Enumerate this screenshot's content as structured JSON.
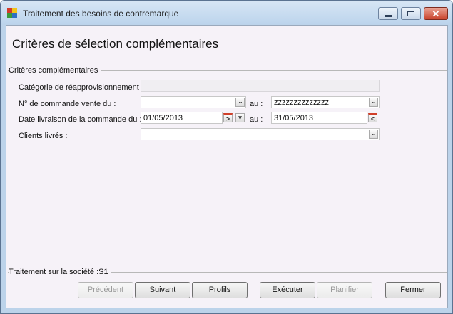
{
  "window": {
    "title": "Traitement des besoins de contremarque",
    "minimize_icon": "minimize-icon",
    "maximize_icon": "maximize-icon",
    "close_glyph": "✕",
    "colors": {
      "frame": "#bcd3ea",
      "client": "#f6f2f8",
      "close": "#c9432c"
    }
  },
  "page": {
    "title": "Critères de sélection complémentaires"
  },
  "criteria": {
    "group_label": "Critères complémentaires",
    "categorie": {
      "label": "Catégorie de réapprovisionnement :",
      "value": ""
    },
    "commande": {
      "label": "N° de commande vente du :",
      "from_value": "",
      "to_label": "au :",
      "to_value": "zzzzzzzzzzzzzz",
      "dots": "..."
    },
    "date_livraison": {
      "label": "Date livraison de la commande du :",
      "from_value": "01/05/2013",
      "to_label": "au :",
      "to_value": "31/05/2013",
      "next_glyph": ">",
      "dropdown_glyph": "▾",
      "prev_glyph": "<"
    },
    "clients": {
      "label": "Clients livrés :",
      "value": "",
      "dots": "..."
    }
  },
  "footer": {
    "societe_label": "Traitement sur la société :S1",
    "buttons": {
      "precedent": "Précédent",
      "suivant": "Suivant",
      "profils": "Profils",
      "executer": "Exécuter",
      "planifier": "Planifier",
      "fermer": "Fermer"
    }
  }
}
